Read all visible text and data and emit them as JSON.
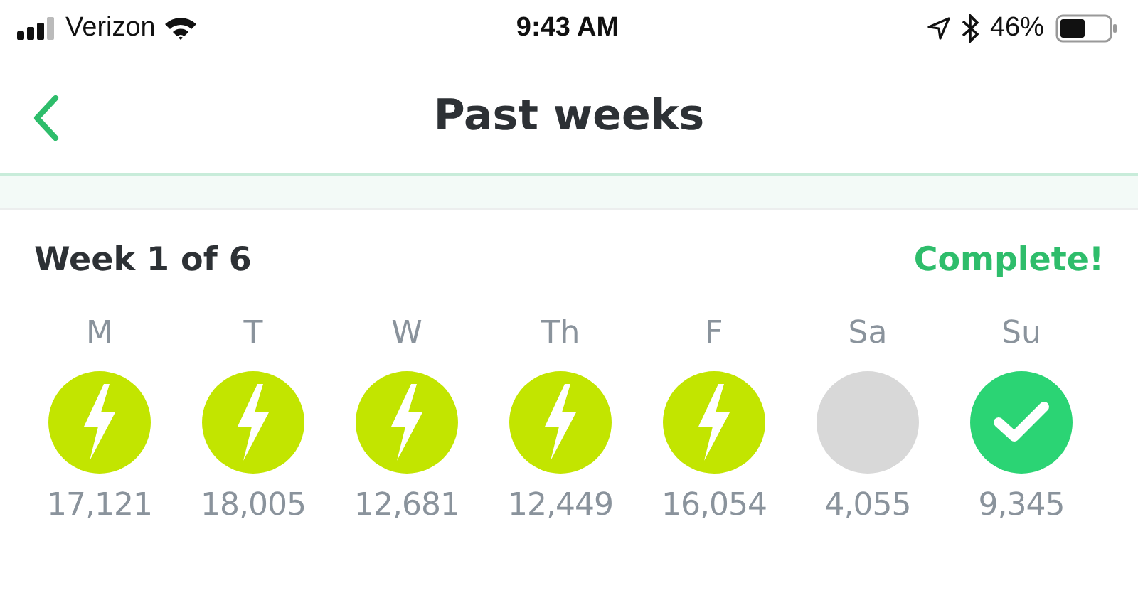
{
  "status_bar": {
    "carrier": "Verizon",
    "time": "9:43 AM",
    "battery": "46%"
  },
  "nav": {
    "title": "Past weeks"
  },
  "week": {
    "title": "Week 1 of 6",
    "status": "Complete!",
    "days": [
      {
        "label": "M",
        "kind": "bolt",
        "steps": "17,121"
      },
      {
        "label": "T",
        "kind": "bolt",
        "steps": "18,005"
      },
      {
        "label": "W",
        "kind": "bolt",
        "steps": "12,681"
      },
      {
        "label": "Th",
        "kind": "bolt",
        "steps": "12,449"
      },
      {
        "label": "F",
        "kind": "bolt",
        "steps": "16,054"
      },
      {
        "label": "Sa",
        "kind": "none",
        "steps": "4,055"
      },
      {
        "label": "Su",
        "kind": "check",
        "steps": "9,345"
      }
    ]
  }
}
